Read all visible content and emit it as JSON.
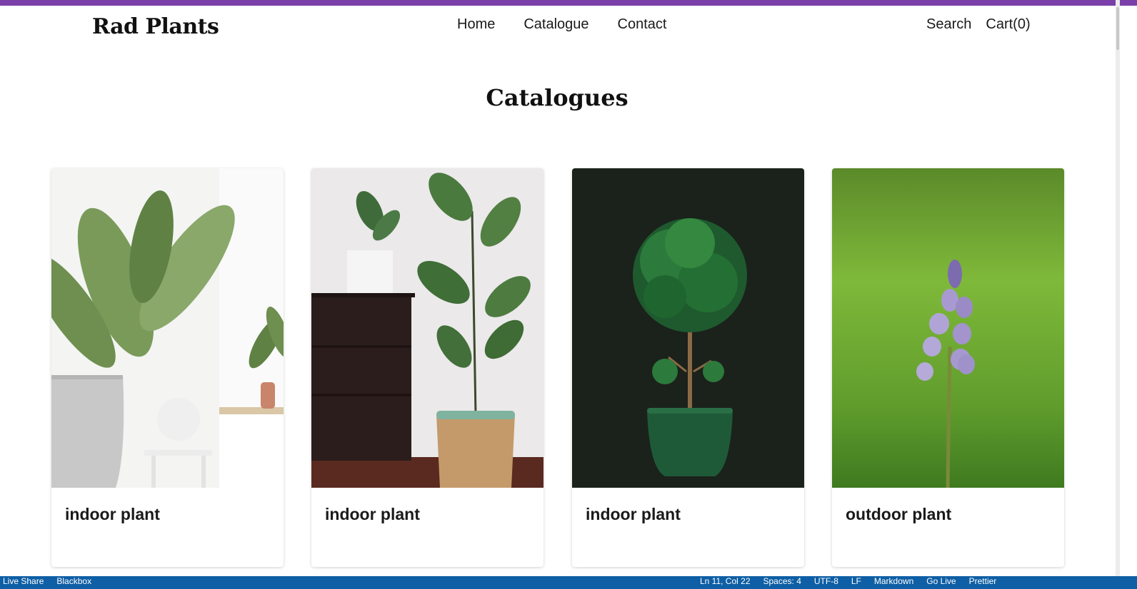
{
  "app": {
    "brand": "Rad Plants",
    "accent_color": "#7a3fa8"
  },
  "nav": {
    "links": [
      "Home",
      "Catalogue",
      "Contact"
    ],
    "search_label": "Search",
    "cart_label": "Cart(0)"
  },
  "page": {
    "title": "Catalogues"
  },
  "cards": [
    {
      "label": "indoor plant",
      "image": "plant-photo-white-room"
    },
    {
      "label": "indoor plant",
      "image": "fiddle-leaf-fig-photo"
    },
    {
      "label": "indoor plant",
      "image": "topiary-tree-photo"
    },
    {
      "label": "outdoor plant",
      "image": "bluebell-flower-photo"
    }
  ],
  "statusbar": {
    "left": [
      "Live Share",
      "Blackbox"
    ],
    "right": [
      "Ln 11, Col 22",
      "Spaces: 4",
      "UTF-8",
      "LF",
      "Markdown",
      "Go Live",
      "Prettier"
    ],
    "color": "#0e5fa5"
  }
}
